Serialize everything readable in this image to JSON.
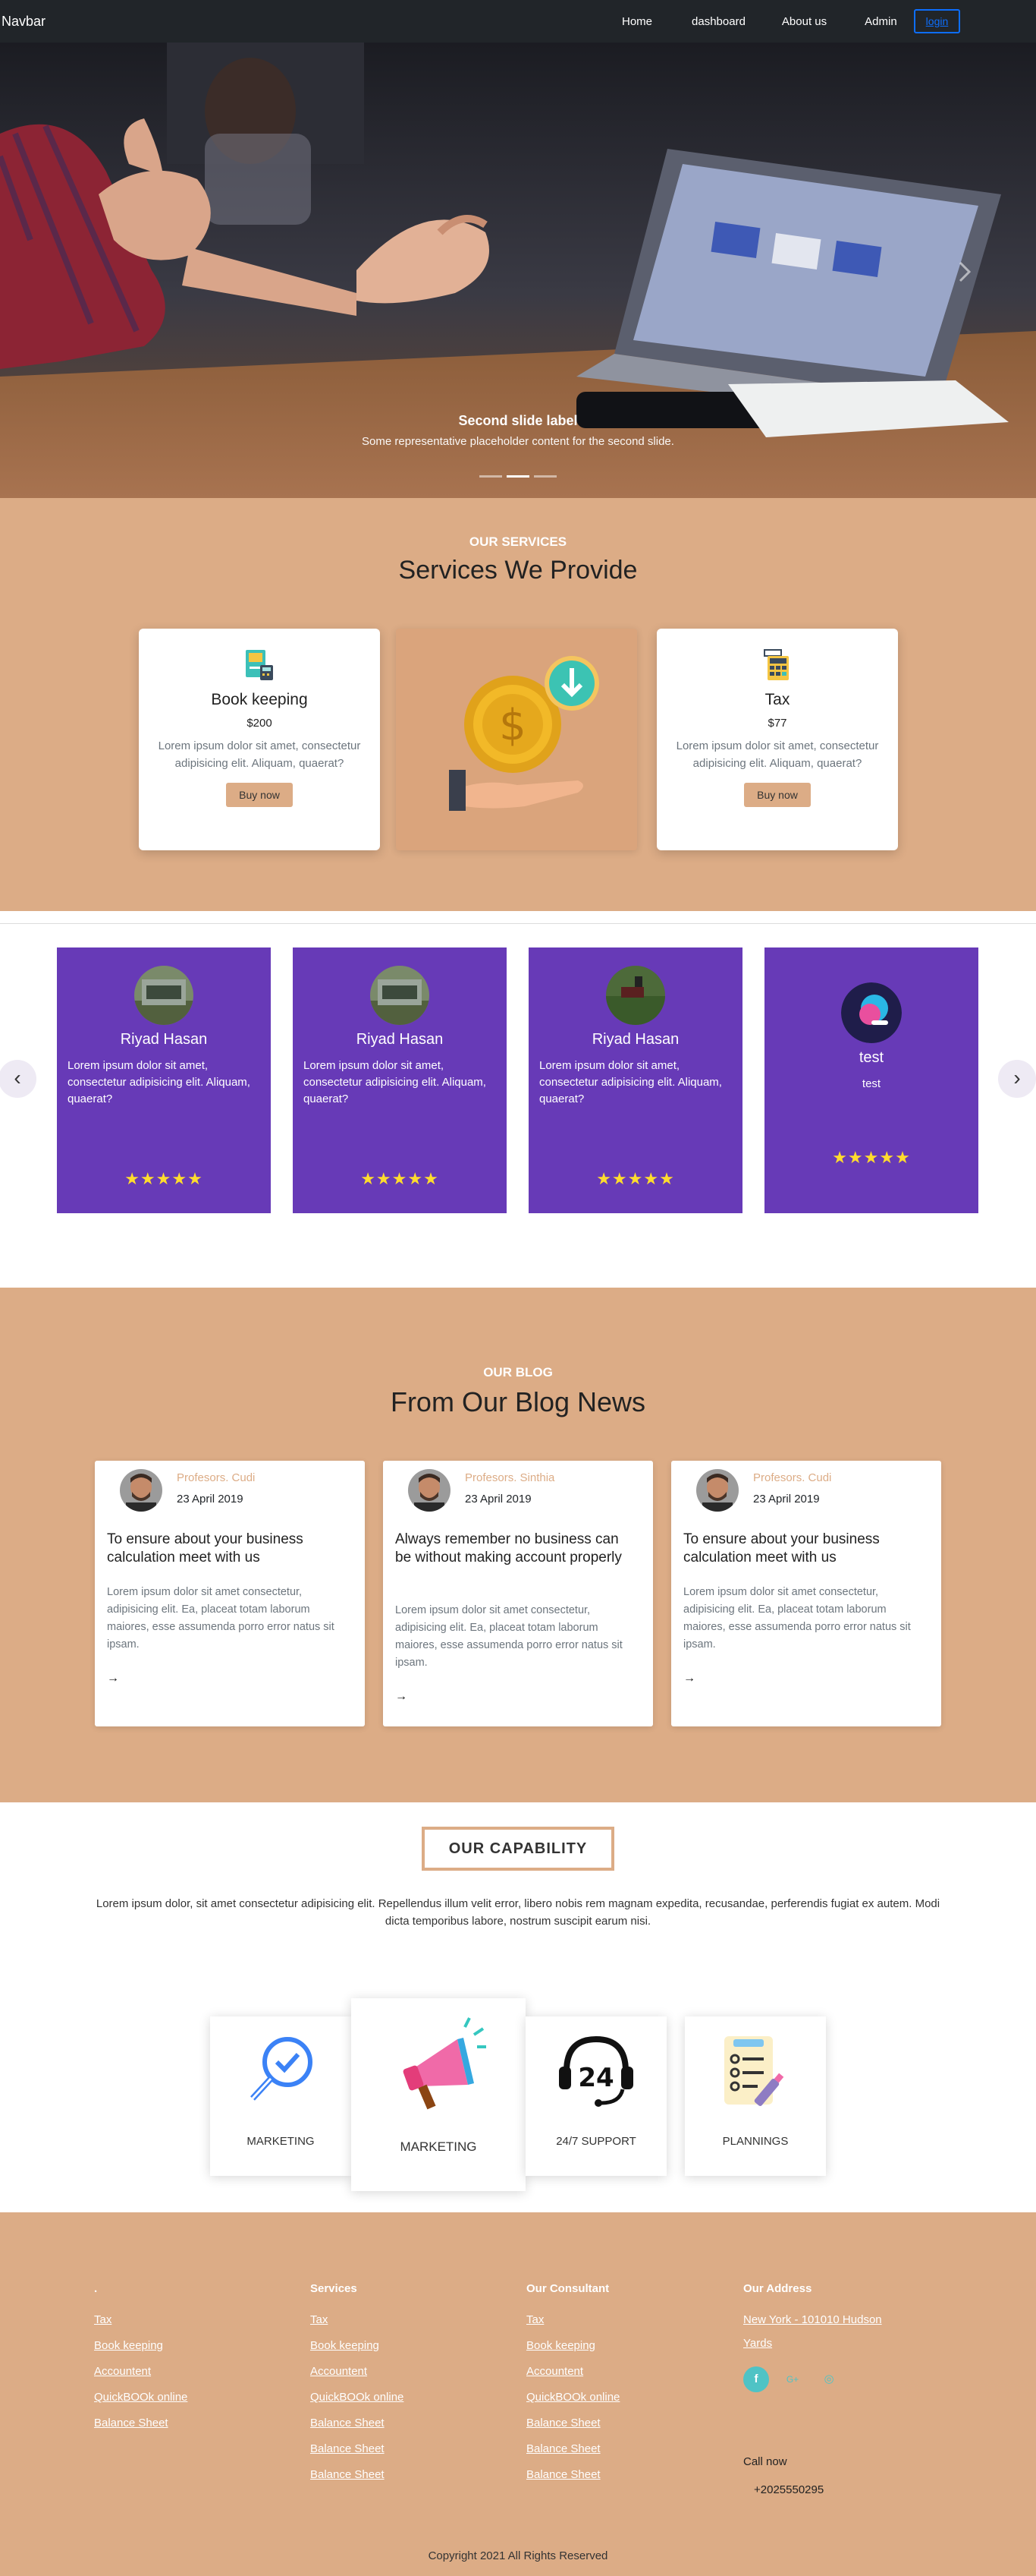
{
  "navbar": {
    "brand": "Navbar",
    "links": [
      "Home",
      "dashboard",
      "About us",
      "Admin"
    ],
    "login": "login"
  },
  "hero": {
    "title": "Second slide label",
    "text": "Some representative placeholder content for the second slide.",
    "slide_count": 3,
    "active_slide": 2
  },
  "services": {
    "eyebrow": "OUR SERVICES",
    "title": "Services We Provide",
    "cards": [
      {
        "name": "Book keeping",
        "price": "$200",
        "desc": "Lorem ipsum dolor sit amet, consectetur adipisicing elit. Aliquam, quaerat?",
        "button": "Buy now",
        "icon": "book-keeping-icon"
      },
      {
        "name": "Tax",
        "price": "$77",
        "desc": "Lorem ipsum dolor sit amet, consectetur adipisicing elit. Aliquam, quaerat?",
        "button": "Buy now",
        "icon": "calculator-icon"
      }
    ]
  },
  "reviews": {
    "cards": [
      {
        "name": "Riyad Hasan",
        "text": "Lorem ipsum dolor sit amet, consectetur adipisicing elit. Aliquam, quaerat?",
        "rating": 5
      },
      {
        "name": "Riyad Hasan",
        "text": "Lorem ipsum dolor sit amet, consectetur adipisicing elit. Aliquam, quaerat?",
        "rating": 5
      },
      {
        "name": "Riyad Hasan",
        "text": "Lorem ipsum dolor sit amet, consectetur adipisicing elit. Aliquam, quaerat?",
        "rating": 5
      },
      {
        "name": "test",
        "text": "test",
        "rating": 5
      }
    ],
    "stars": "★★★★★",
    "prev": "‹",
    "next": "›",
    "pages": 2,
    "active_page": 1
  },
  "blog": {
    "eyebrow": "OUR BLOG",
    "title": "From Our Blog News",
    "posts": [
      {
        "author": "Profesors. Cudi",
        "date": "23 April 2019",
        "title": "To ensure about your business calculation meet with us",
        "excerpt": "Lorem ipsum dolor sit amet consectetur, adipisicing elit. Ea, placeat totam laborum maiores, esse assumenda porro error natus sit ipsam.",
        "arrow": "→"
      },
      {
        "author": "Profesors. Sinthia",
        "date": "23 April 2019",
        "title": "Always remember no business can be without making account properly",
        "excerpt": "Lorem ipsum dolor sit amet consectetur, adipisicing elit. Ea, placeat totam laborum maiores, esse assumenda porro error natus sit ipsam.",
        "arrow": "→"
      },
      {
        "author": "Profesors. Cudi",
        "date": "23 April 2019",
        "title": "To ensure about your business calculation meet with us",
        "excerpt": "Lorem ipsum dolor sit amet consectetur, adipisicing elit. Ea, placeat totam laborum maiores, esse assumenda porro error natus sit ipsam.",
        "arrow": "→"
      }
    ]
  },
  "capability": {
    "title": "OUR CAPABILITY",
    "text": "Lorem ipsum dolor, sit amet consectetur adipisicing elit. Repellendus illum velit error, libero nobis rem magnam expedita, recusandae, perferendis fugiat ex autem. Modi dicta temporibus labore, nostrum suscipit earum nisi.",
    "items": [
      {
        "label": "MARKETING",
        "icon": "search-check-icon"
      },
      {
        "label": "MARKETING",
        "icon": "megaphone-icon"
      },
      {
        "label": "24/7 SUPPORT",
        "icon": "support-headset-icon"
      },
      {
        "label": "PLANNINGS",
        "icon": "checklist-icon"
      }
    ]
  },
  "footer": {
    "columns": [
      {
        "head": ".",
        "links": [
          "Tax",
          "Book keeping",
          "Accountent",
          "QuickBOOk online",
          "Balance Sheet"
        ]
      },
      {
        "head": "Services",
        "links": [
          "Tax",
          "Book keeping",
          "Accountent",
          "QuickBOOk online",
          "Balance Sheet",
          "Balance Sheet",
          "Balance Sheet"
        ]
      },
      {
        "head": "Our Consultant",
        "links": [
          "Tax",
          "Book keeping",
          "Accountent",
          "QuickBOOk online",
          "Balance Sheet",
          "Balance Sheet",
          "Balance Sheet"
        ]
      }
    ],
    "address_head": "Our Address",
    "address_line1": "New York - 101010 Hudson",
    "address_line2": "Yards",
    "social": {
      "facebook": "f",
      "google": "G+",
      "instagram": "◎"
    },
    "call_label": "Call now",
    "call_number": "+2025550295",
    "copyright": "Copyright 2021 All Rights Reserved"
  },
  "colors": {
    "accent": "#dcac86",
    "review_purple": "#673ab7",
    "navbar_bg": "#212529",
    "login_blue": "#0d6efd",
    "social_teal": "#4fc3c5",
    "star_yellow": "#ffdc2e"
  }
}
